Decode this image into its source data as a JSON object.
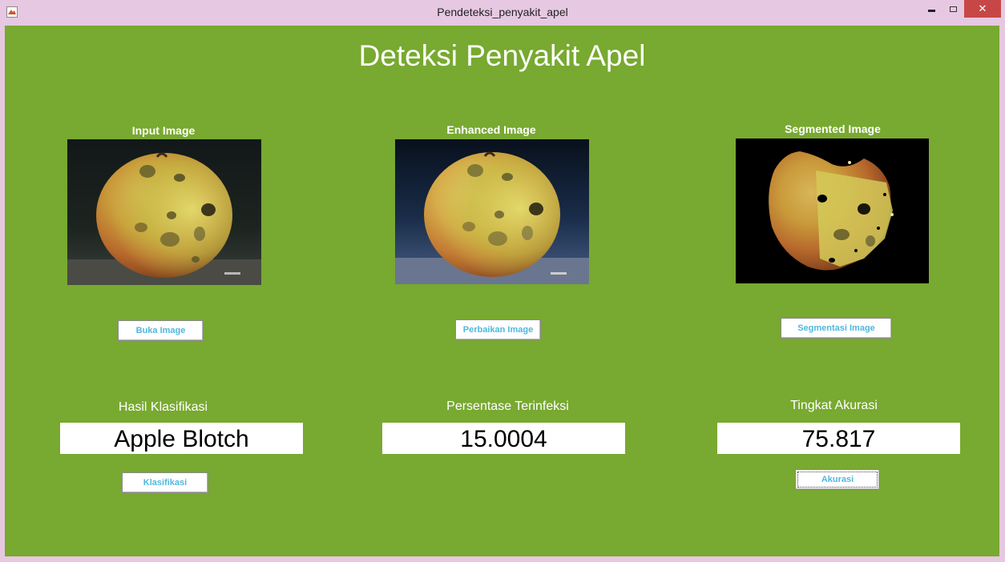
{
  "window": {
    "title": "Pendeteksi_penyakit_apel",
    "close_glyph": "✕"
  },
  "app": {
    "title": "Deteksi Penyakit Apel"
  },
  "panels": [
    {
      "title": "Input Image",
      "button": "Buka Image",
      "icon": "apple-photo"
    },
    {
      "title": "Enhanced Image",
      "button": "Perbaikan Image",
      "icon": "apple-photo-enhanced"
    },
    {
      "title": "Segmented Image",
      "button": "Segmentasi Image",
      "icon": "apple-photo-segmented"
    }
  ],
  "results": {
    "classification": {
      "label": "Hasil Klasifikasi",
      "value": "Apple Blotch",
      "button": "Klasifikasi"
    },
    "infected": {
      "label": "Persentase Terinfeksi",
      "value": "15.0004"
    },
    "accuracy": {
      "label": "Tingkat Akurasi",
      "value": "75.817",
      "button": "Akurasi"
    }
  },
  "colors": {
    "background": "#78a930",
    "titlebar": "#e6c8e2",
    "close_button": "#c74747",
    "button_text": "#4fb7df"
  }
}
